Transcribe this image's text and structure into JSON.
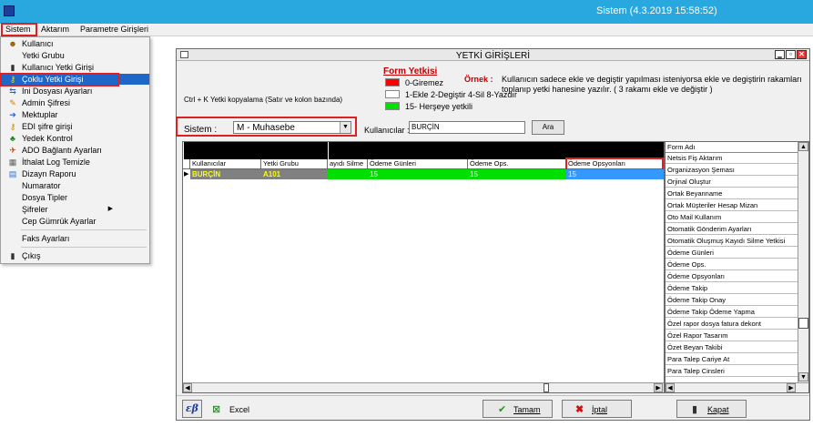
{
  "app": {
    "title": "Sistem (4.3.2019 15:58:52)"
  },
  "menubar": {
    "items": [
      "Sistem",
      "Aktarım",
      "Parametre Girişleri"
    ]
  },
  "sistem_menu": {
    "items": [
      {
        "label": "Kullanıcı",
        "icon": "user-icon"
      },
      {
        "label": "Yetki Grubu",
        "icon": ""
      },
      {
        "label": "Kullanıcı Yetki Girişi",
        "icon": "door-icon"
      },
      {
        "label": "Çoklu Yetki Girişi",
        "icon": "key-icon"
      },
      {
        "label": "Ini Dosyası  Ayarları",
        "icon": "arrows-icon"
      },
      {
        "label": "Admin Şifresi",
        "icon": "pencil-icon"
      },
      {
        "label": "Mektuplar",
        "icon": "arrow-icon"
      },
      {
        "label": "EDI şifre girişi",
        "icon": "key-icon"
      },
      {
        "label": "Yedek Kontrol",
        "icon": "tree-icon"
      },
      {
        "label": "ADO Bağlantı Ayarları",
        "icon": "plug-icon"
      },
      {
        "label": "İthalat Log Temizle",
        "icon": "broom-icon"
      },
      {
        "label": "Dizayn Raporu",
        "icon": "report-icon"
      },
      {
        "label": "Numarator",
        "icon": ""
      },
      {
        "label": "Dosya Tipler",
        "icon": ""
      },
      {
        "label": "Şifreler",
        "icon": ""
      },
      {
        "label": "Cep Gümrük Ayarlar",
        "icon": ""
      },
      {
        "label": "Faks Ayarları",
        "icon": ""
      },
      {
        "label": "Çıkış",
        "icon": "exit-door-icon"
      }
    ]
  },
  "window": {
    "title": "YETKİ GİRİŞLERİ",
    "copy_hint": "Ctrl + K Yetki kopyalama (Satır ve kolon bazında)",
    "legend": {
      "title": "Form Yetkisi",
      "items": [
        {
          "label": "0-Giremez",
          "color": "#ff0000"
        },
        {
          "label": "1-Ekle  2-Degiştir  4-Sil  8-Yazdır",
          "color": "#ffffff"
        },
        {
          "label": "15- Herşeye yetkili",
          "color": "#00e000"
        }
      ]
    },
    "example": {
      "label": "Örnek :",
      "text": "Kullanıcın sadece ekle ve degiştir yapılması isteniyorsa  ekle ve degiştirin rakamları toplanıp yetki hanesine yazılır.  ( 3 rakamı ekle ve değiştir )"
    },
    "sistem_label": "Sistem :",
    "sistem_value": "M - Muhasebe",
    "kullanicilar_label": "Kullanıcılar :",
    "kullanicilar_value": "BURÇİN",
    "ara_label": "Ara",
    "grid": {
      "columns": [
        "Kullanıcılar",
        "Yetki Grubu",
        "ayıdı Silme",
        "Ödeme Günleri",
        "Ödeme Ops.",
        "Ödeme Opsyonları"
      ],
      "rows": [
        {
          "kullanici": "BURÇİN",
          "yetki_grubu": "A101",
          "values": [
            "",
            "15",
            "15",
            "15"
          ]
        }
      ]
    },
    "form_list": {
      "header": "Form Adı",
      "items": [
        "Netsis Fiş Aktarım",
        "Organizasyon Şeması",
        "Orjinal Oluştur",
        "Ortak Beyanname",
        "Ortak Müşteriler Hesap Mizan",
        "Oto Mail Kullanım",
        "Otomatik Gönderim Ayarları",
        "Otomatik Oluşmuş Kayıdı Silme Yetkisi",
        "Ödeme Günleri",
        "Ödeme Ops.",
        "Ödeme Opsyonları",
        "Ödeme Takip",
        "Ödeme Takip Onay",
        "Ödeme Takip Ödeme Yapma",
        "Özel rapor dosya fatura dekont",
        "Özel Rapor Tasarım",
        "Özet Beyan Takibi",
        "Para Talep Cariye At",
        "Para Talep Cinsleri"
      ]
    },
    "buttons": {
      "excel": "Excel",
      "tamam": "Tamam",
      "iptal": "İptal",
      "kapat": "Kapat"
    }
  }
}
